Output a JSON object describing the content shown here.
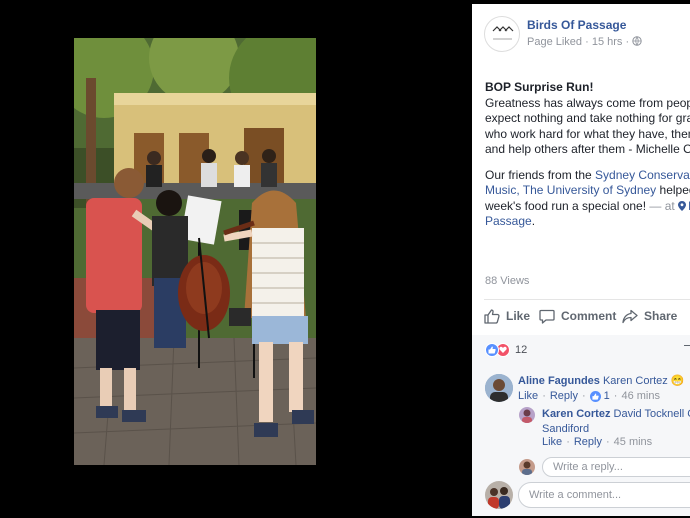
{
  "post": {
    "page_name": "Birds Of Passage",
    "page_status": "Page Liked",
    "time": "15 hrs",
    "title": "BOP Surprise Run!",
    "quote_lines": [
      "Greatness has always come from peopl",
      "expect nothing and take nothing for gran",
      "who work hard for what they have, then",
      "and help others after them - Michelle Ob"
    ],
    "para2_start": "Our friends from the ",
    "link1_line1": "Sydney Conservato",
    "link1_line2": "Music, The University of Sydney",
    "para2_mid1": " helped",
    "para2_line3": "week's food run a special one!",
    "at_text": " — at ",
    "location_line1": "B",
    "location_line2": "Passage",
    "period": ".",
    "views": "88 Views"
  },
  "actions": {
    "like": "Like",
    "comment": "Comment",
    "share": "Share"
  },
  "reactions": {
    "count": "12"
  },
  "comments": [
    {
      "author": "Aline Fagundes",
      "mention": "Karen Cortez",
      "emoji": "😁",
      "like": "Like",
      "reply": "Reply",
      "likes": "1",
      "time": "46 mins"
    }
  ],
  "reply": {
    "author": "Karen Cortez",
    "mention_line1": "David Tocknell Cai",
    "mention_line2": "Sandiford",
    "like": "Like",
    "reply": "Reply",
    "time": "45 mins"
  },
  "inputs": {
    "reply_placeholder": "Write a reply...",
    "comment_placeholder": "Write a comment..."
  },
  "colors": {
    "link": "#365899",
    "muted": "#90949c",
    "like_blue": "#5890ff",
    "love_red": "#f25268"
  }
}
